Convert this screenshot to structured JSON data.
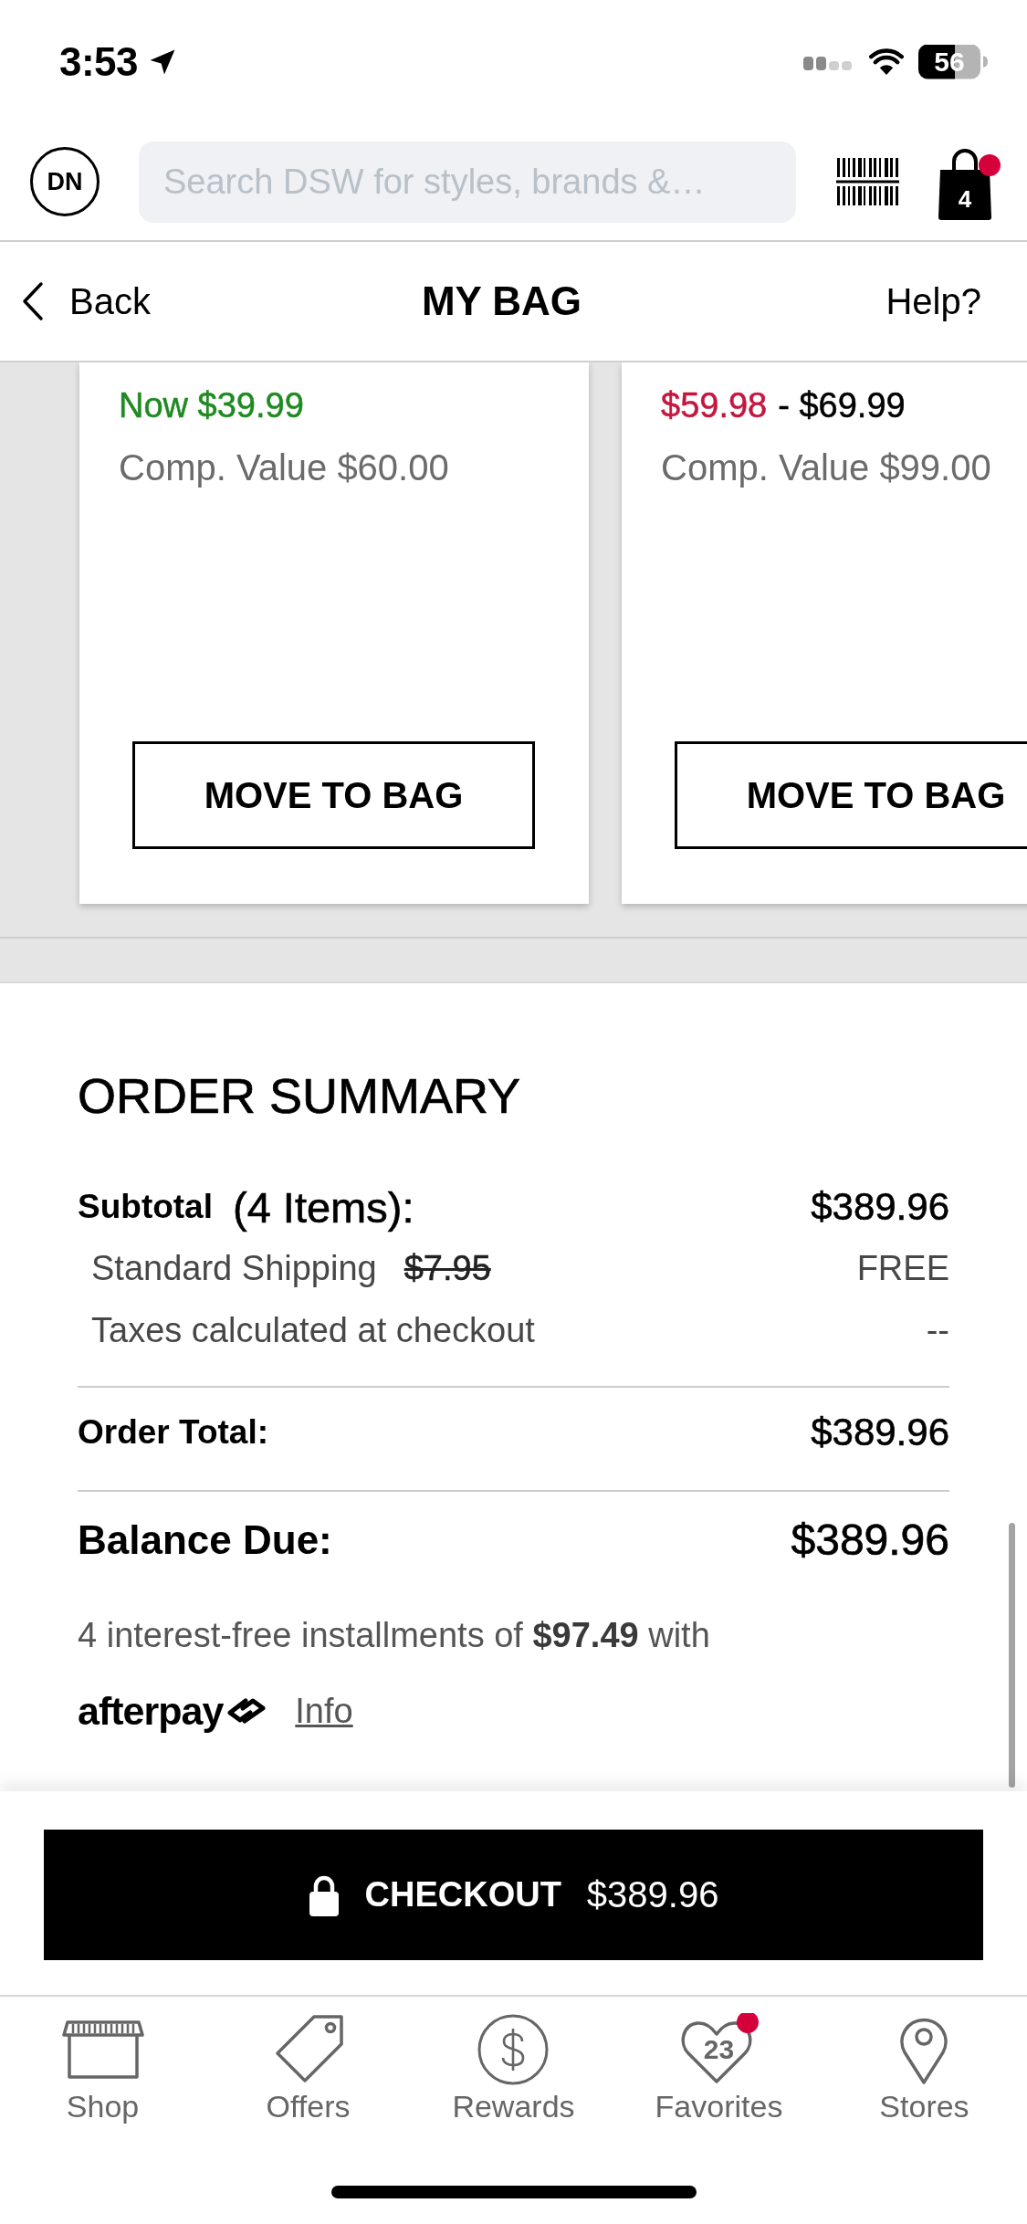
{
  "status_bar": {
    "time": "3:53",
    "battery": "56"
  },
  "header": {
    "avatar": "DN",
    "search": {
      "placeholder": "Search DSW for styles, brands &…"
    },
    "bag": {
      "count": "4",
      "alert": true
    }
  },
  "nav": {
    "back": "Back",
    "title": "MY BAG",
    "help": "Help?"
  },
  "saved_items": [
    {
      "price": [
        {
          "kind": "now",
          "text": "Now $39.99"
        }
      ],
      "comp_value": "Comp. Value $60.00",
      "button": "MOVE TO BAG"
    },
    {
      "price": [
        {
          "kind": "sale",
          "text": "$59.98"
        },
        {
          "kind": "regular",
          "text": "- $69.99"
        }
      ],
      "comp_value": "Comp. Value $99.00",
      "button": "MOVE TO BAG"
    }
  ],
  "order_summary": {
    "title": "ORDER SUMMARY",
    "lines": [
      {
        "kind": "subtotal",
        "label": "Subtotal",
        "detail": "(4 Items):",
        "value": "$389.96"
      },
      {
        "kind": "charge",
        "label": "Standard Shipping",
        "struck": "$7.95",
        "value": "FREE"
      },
      {
        "kind": "charge",
        "label": "Taxes calculated at checkout",
        "value": "--"
      },
      {
        "kind": "total",
        "label": "Order Total:",
        "value": "$389.96"
      },
      {
        "kind": "balance",
        "label": "Balance Due:",
        "value": "$389.96"
      }
    ],
    "installments": "4 interest-free installments of **$97.49** with",
    "pay_later": {
      "logo": "afterpay",
      "link": "Info"
    }
  },
  "checkout": {
    "label": "CHECKOUT",
    "amount": "$389.96"
  },
  "tabs": [
    {
      "label": "Shop",
      "selected": false,
      "alert": false
    },
    {
      "label": "Offers",
      "selected": false,
      "alert": false
    },
    {
      "label": "Rewards",
      "selected": false,
      "alert": false
    },
    {
      "label": "Favorites",
      "selected": false,
      "badge": "23",
      "alert": true
    },
    {
      "label": "Stores",
      "selected": false,
      "alert": false
    }
  ]
}
